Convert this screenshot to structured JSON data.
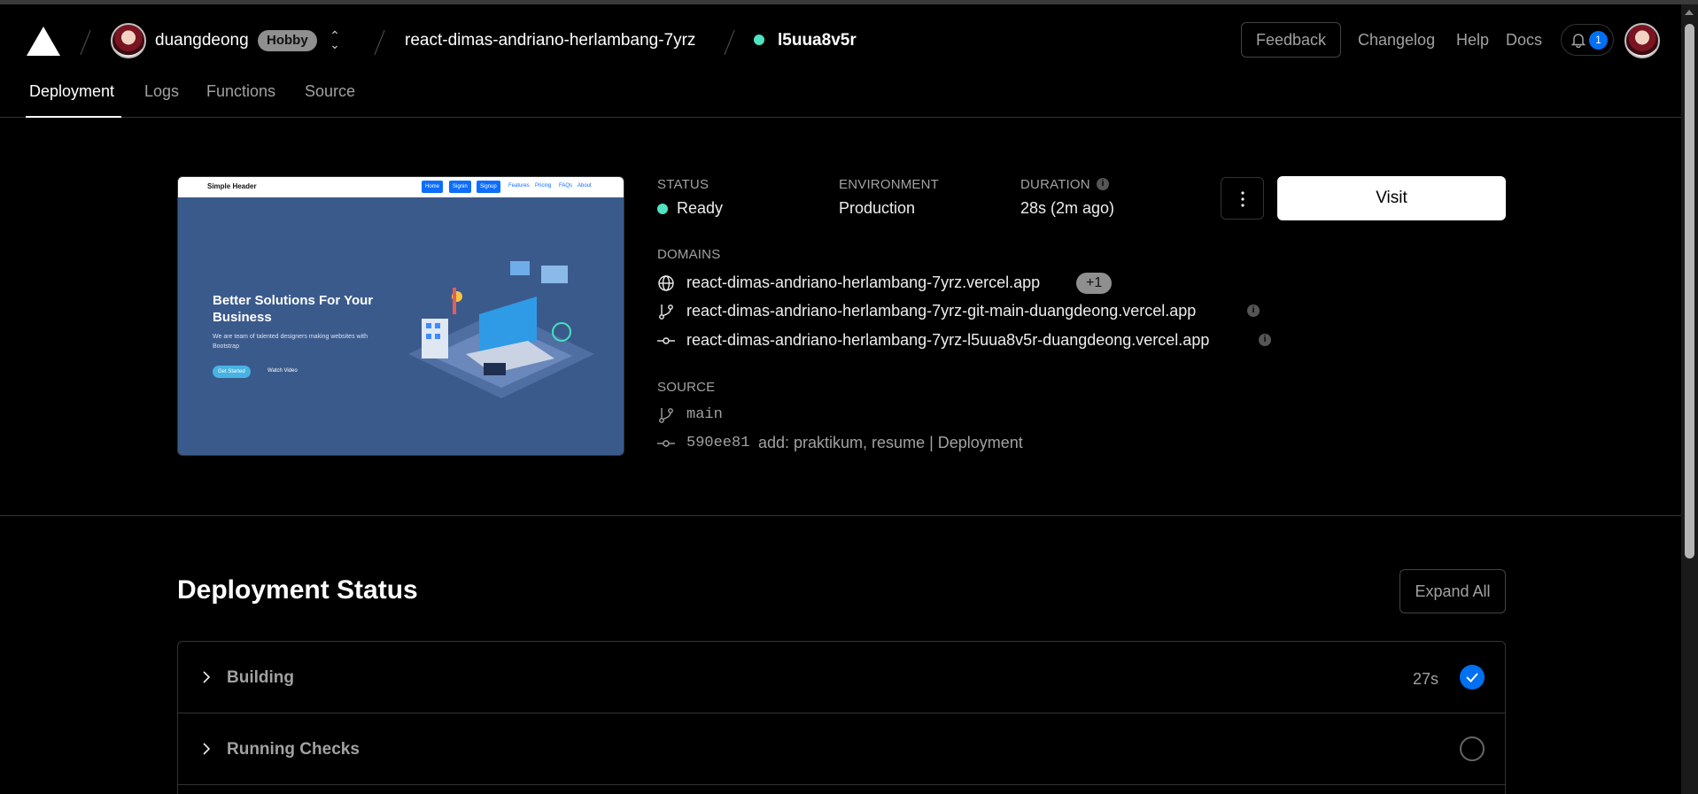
{
  "header": {
    "team": {
      "name": "duangdeong",
      "plan": "Hobby"
    },
    "project": "react-dimas-andriano-herlambang-7yrz",
    "deployment_id": "l5uua8v5r",
    "feedback_label": "Feedback",
    "links": [
      "Changelog",
      "Help",
      "Docs"
    ],
    "notification_count": "1"
  },
  "tabs": [
    "Deployment",
    "Logs",
    "Functions",
    "Source"
  ],
  "active_tab": "Deployment",
  "preview": {
    "brand": "Simple Header",
    "buttons": [
      "Home",
      "Signin",
      "Signup"
    ],
    "links": [
      "Features",
      "Pricing",
      "FAQs",
      "About"
    ],
    "headline": "Better Solutions For Your Business",
    "subtext": "We are team of talented designers making websites with Bootstrap",
    "cta": "Get Started",
    "video": "Watch Video"
  },
  "summary": {
    "status_label": "STATUS",
    "status_value": "Ready",
    "environment_label": "ENVIRONMENT",
    "environment_value": "Production",
    "duration_label": "DURATION",
    "duration_value": "28s (2m ago)",
    "visit_label": "Visit",
    "domains_label": "DOMAINS",
    "domains": [
      "react-dimas-andriano-herlambang-7yrz.vercel.app",
      "react-dimas-andriano-herlambang-7yrz-git-main-duangdeong.vercel.app",
      "react-dimas-andriano-herlambang-7yrz-l5uua8v5r-duangdeong.vercel.app"
    ],
    "extra_domains": "+1",
    "source_label": "SOURCE",
    "branch": "main",
    "commit_sha": "590ee81",
    "commit_message": "add: praktikum, resume | Deployment"
  },
  "deployment_status": {
    "title": "Deployment Status",
    "expand_label": "Expand All",
    "steps": [
      {
        "name": "Building",
        "time": "27s",
        "state": "done"
      },
      {
        "name": "Running Checks",
        "time": "",
        "state": "pending"
      }
    ]
  },
  "colors": {
    "ready": "#50e3c2",
    "accent": "#0070f3"
  },
  "icons": [
    "vercel-logo-icon",
    "chevron-up-down-icon",
    "bell-icon",
    "info-icon",
    "more-vertical-icon",
    "globe-icon",
    "git-branch-icon",
    "git-commit-icon",
    "chevron-right-icon",
    "check-icon"
  ]
}
